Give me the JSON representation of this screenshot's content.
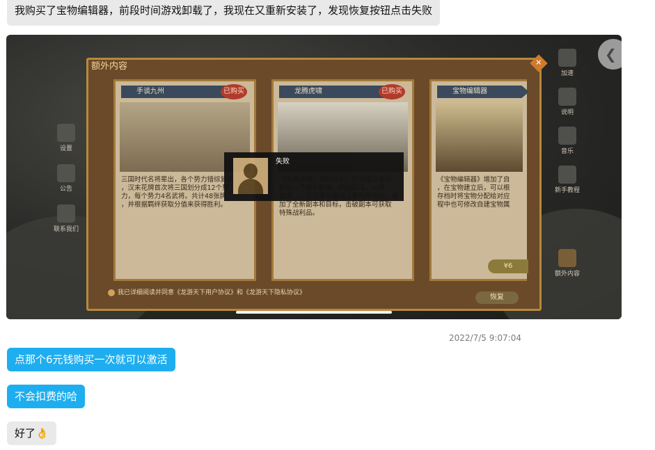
{
  "messages": [
    {
      "text": "我购买了宝物编辑器，前段时间游戏卸载了，我现在又重新安装了，发现恢复按钮点击失败"
    },
    {
      "text": "点那个6元钱购买一次就可以激活"
    },
    {
      "text": "不会扣费的哈"
    },
    {
      "text": "好了👌"
    }
  ],
  "timestamp": "2022/7/5 9:07:04",
  "game": {
    "panel_title": "额外内容",
    "cards": [
      {
        "title": "手谈九州",
        "badge": "已购买",
        "desc": "三国时代名将辈出，各个势力错综复杂\n，汉末花牌首次将三国划分成12个势\n力，每个势力4名武将。共计48张牌\n，并根据羁绊获取分值来获得胜利。"
      },
      {
        "title": "龙腾虎啸",
        "badge": "已购买",
        "desc": "《龙腾虎啸》资料片中，在原版汉末中\n新加入了精彩剧情、挑战玩法、山海\n兽等……且在原有基础上重构精细化，增\n加了全新副本和目标，击破副本可获取\n特殊战利品。"
      },
      {
        "title": "宝物编辑器",
        "badge": "",
        "desc": "《宝物编辑器》增加了自\n，在宝物建立后，可以根\n存档时将宝物分配给对应\n程中也可修改自建宝物属",
        "price": "¥6"
      }
    ],
    "agree_text": "我已详细阅读并同意《龙游天下用户协议》和《龙游天下隐私协议》",
    "restore_label": "恢复",
    "popup": {
      "text": "失败"
    },
    "left_menu": [
      "设置",
      "公告",
      "联系我们"
    ],
    "right_menu": [
      "加速",
      "说明",
      "音乐",
      "新手教程",
      "额外内容"
    ]
  }
}
